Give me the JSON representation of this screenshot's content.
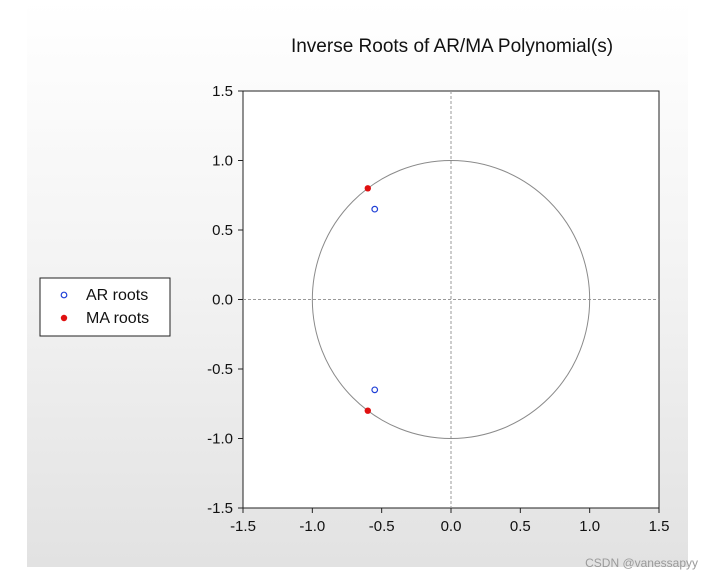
{
  "chart_data": {
    "type": "scatter",
    "title": "Inverse Roots of AR/MA Polynomial(s)",
    "xlim": [
      -1.5,
      1.5
    ],
    "ylim": [
      -1.5,
      1.5
    ],
    "x_ticks": [
      "-1.5",
      "-1.0",
      "-0.5",
      "0.0",
      "0.5",
      "1.0",
      "1.5"
    ],
    "y_ticks": [
      "1.5",
      "1.0",
      "0.5",
      "0.0",
      "-0.5",
      "-1.0",
      "-1.5"
    ],
    "unit_circle": true,
    "reference_lines": "dashed x=0 and y=0",
    "legend_position": "left",
    "series": [
      {
        "name": "AR roots",
        "marker": "hollow-circle",
        "color": "#1f3fd6",
        "points": [
          {
            "x": -0.55,
            "y": 0.65
          },
          {
            "x": -0.55,
            "y": -0.65
          }
        ]
      },
      {
        "name": "MA roots",
        "marker": "filled-circle",
        "color": "#e01010",
        "points": [
          {
            "x": -0.6,
            "y": 0.8
          },
          {
            "x": -0.6,
            "y": -0.8
          }
        ]
      }
    ]
  },
  "watermark": "CSDN @vanessapyy"
}
